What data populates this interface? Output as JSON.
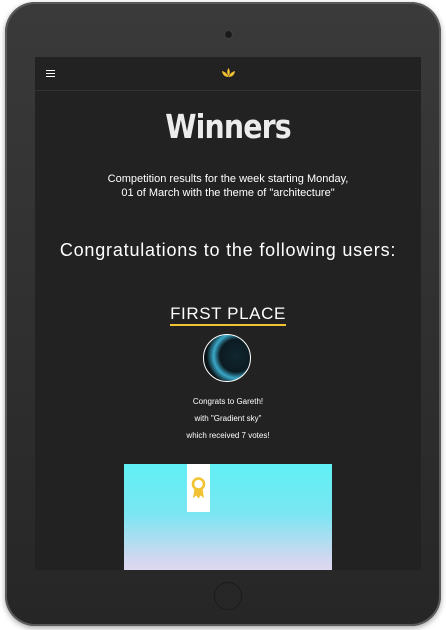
{
  "header": {
    "menu_icon": "hamburger-menu-icon",
    "logo_icon": "lotus-logo-icon",
    "accent_color": "#f1c232"
  },
  "page": {
    "title": "Winners",
    "intro": "Competition results for the week starting Monday, 01 of March with the theme of \"architecture\"",
    "congrats_heading": "Congratulations to the following users:"
  },
  "first_place": {
    "heading": "FIRST PLACE",
    "line1": "Congrats to Gareth!",
    "line2": "with \"Gradient sky\"",
    "line3": "which received 7 votes!",
    "award_icon": "award-ribbon-icon"
  }
}
